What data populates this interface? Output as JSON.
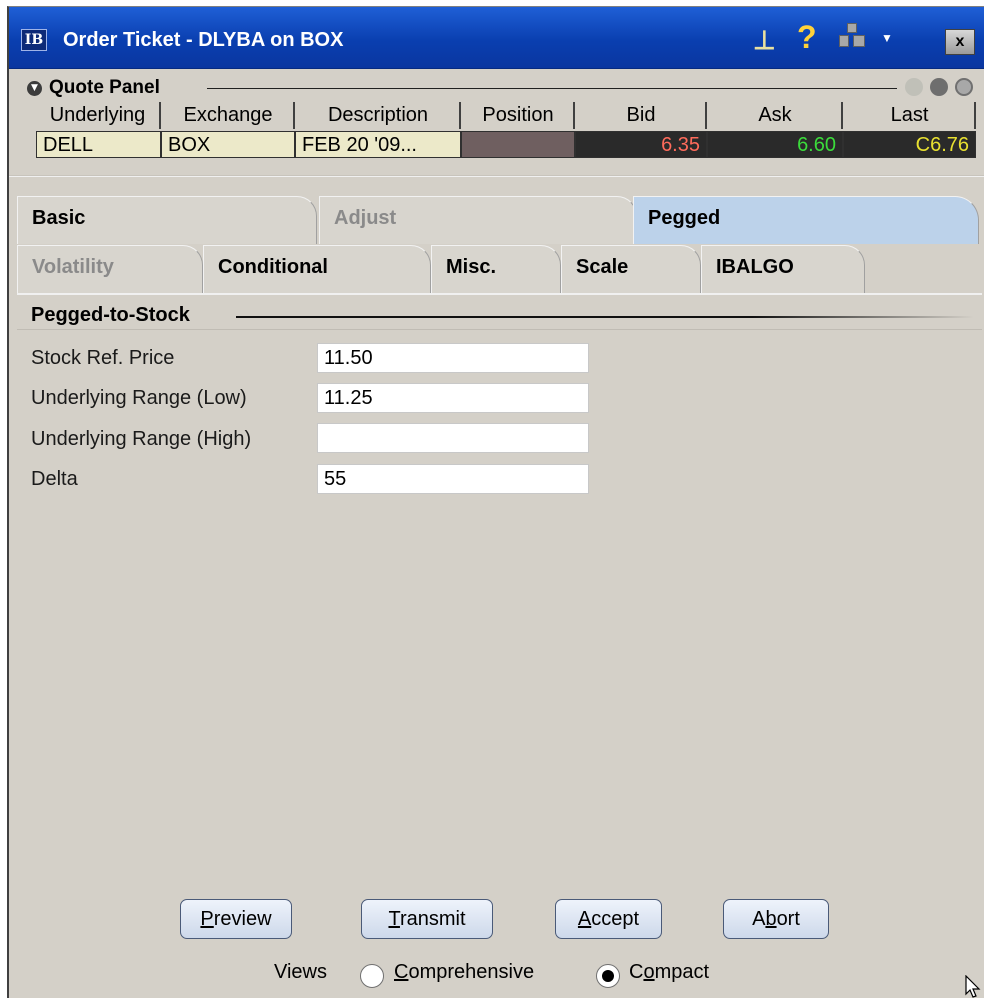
{
  "window": {
    "logo_text": "IB",
    "title": "Order Ticket - DLYBA on BOX",
    "icons": [
      "pin-icon",
      "help-icon",
      "tools-icon",
      "close-icon"
    ],
    "help_glyph": "?",
    "close_glyph": "x"
  },
  "quote_panel": {
    "title": "Quote Panel",
    "columns": [
      "Underlying",
      "Exchange",
      "Description",
      "Position",
      "Bid",
      "Ask",
      "Last"
    ],
    "row": {
      "underlying": "DELL",
      "exchange": "BOX",
      "description": "FEB 20 '09...",
      "position": "",
      "bid": "6.35",
      "ask": "6.60",
      "last": "C6.76"
    },
    "colors": {
      "bid": "#ff6b5b",
      "ask": "#3bdc3b",
      "last": "#e8e030"
    }
  },
  "tabs": {
    "row1": [
      {
        "label": "Basic",
        "state": "normal"
      },
      {
        "label": "Adjust",
        "state": "disabled"
      },
      {
        "label": "Pegged",
        "state": "active"
      }
    ],
    "row2": [
      {
        "label": "Volatility",
        "state": "disabled"
      },
      {
        "label": "Conditional",
        "state": "normal"
      },
      {
        "label": "Misc.",
        "state": "normal"
      },
      {
        "label": "Scale",
        "state": "normal"
      },
      {
        "label": "IBALGO",
        "state": "normal"
      }
    ]
  },
  "pegged": {
    "section_title": "Pegged-to-Stock",
    "fields": [
      {
        "label": "Stock Ref. Price",
        "value": "11.50"
      },
      {
        "label": "Underlying Range (Low)",
        "value": "11.25"
      },
      {
        "label": "Underlying Range (High)",
        "value": ""
      },
      {
        "label": "Delta",
        "value": "55"
      }
    ]
  },
  "buttons": {
    "preview": {
      "pre": "",
      "key": "P",
      "post": "review"
    },
    "transmit": {
      "pre": "",
      "key": "T",
      "post": "ransmit"
    },
    "accept": {
      "pre": "",
      "key": "A",
      "post": "ccept"
    },
    "abort": {
      "pre": "A",
      "key": "b",
      "post": "ort"
    }
  },
  "views": {
    "label": "Views",
    "options": [
      {
        "key": "C",
        "rest": "omprehensive",
        "selected": false
      },
      {
        "pre": "C",
        "key": "o",
        "rest": "mpact",
        "selected": true
      }
    ]
  }
}
